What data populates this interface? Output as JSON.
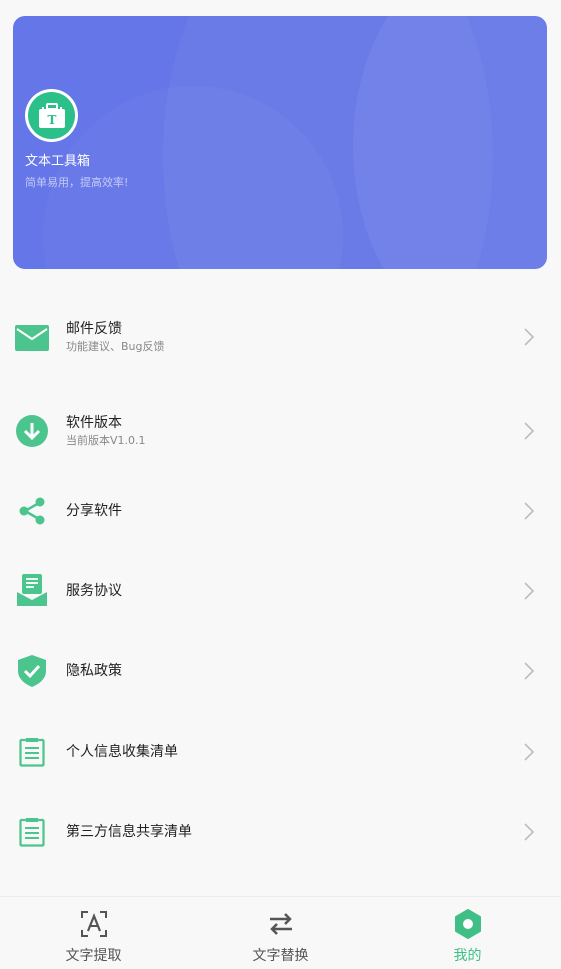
{
  "header": {
    "app_name": "文本工具箱",
    "slogan": "简单易用，提高效率!",
    "logo_letter": "T",
    "accent": "#6476e8"
  },
  "menu": [
    {
      "icon": "mail-icon",
      "title": "邮件反馈",
      "subtitle": "功能建议、Bug反馈"
    },
    {
      "icon": "download-icon",
      "title": "软件版本",
      "subtitle": "当前版本V1.0.1"
    },
    {
      "icon": "share-icon",
      "title": "分享软件"
    },
    {
      "icon": "agreement-icon",
      "title": "服务协议"
    },
    {
      "icon": "shield-check-icon",
      "title": "隐私政策"
    },
    {
      "icon": "list-doc-icon",
      "title": "个人信息收集清单"
    },
    {
      "icon": "list-doc-icon",
      "title": "第三方信息共享清单"
    }
  ],
  "nav": [
    {
      "icon": "text-extract-icon",
      "label": "文字提取",
      "active": false
    },
    {
      "icon": "swap-icon",
      "label": "文字替换",
      "active": false
    },
    {
      "icon": "profile-hex-icon",
      "label": "我的",
      "active": true
    }
  ],
  "colors": {
    "icon_green": "#4cc48d",
    "active_green": "#3fbf86"
  }
}
